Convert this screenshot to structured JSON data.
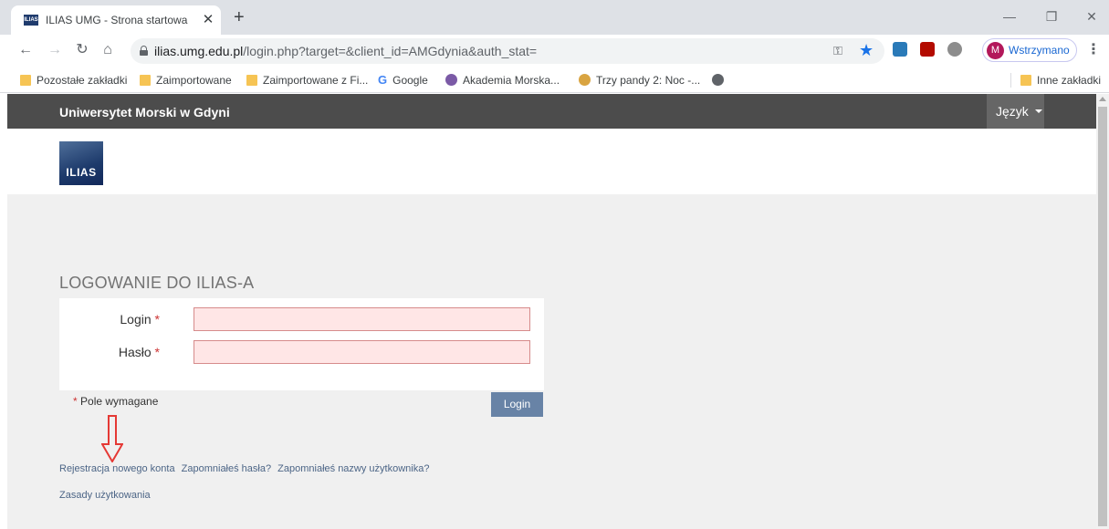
{
  "browser": {
    "tab": {
      "favicon_text": "ILIAS",
      "title": "ILIAS UMG - Strona startowa"
    },
    "window_controls": {
      "minimize": "—",
      "restore": "❐",
      "close": "✕"
    },
    "address": {
      "host": "ilias.umg.edu.pl",
      "path": "/login.php?target=&client_id=AMGdynia&auth_stat="
    },
    "profile": {
      "initial": "M",
      "label": "Wstrzymano"
    },
    "bookmarks": [
      {
        "label": "Pozostałe zakładki",
        "icon": "folder-icon"
      },
      {
        "label": "Zaimportowane",
        "icon": "folder-icon"
      },
      {
        "label": "Zaimportowane z Fi...",
        "icon": "folder-icon"
      },
      {
        "label": "Google",
        "icon": "google-icon"
      },
      {
        "label": "Akademia Morska...",
        "icon": "crest-icon"
      },
      {
        "label": "Trzy pandy 2: Noc -...",
        "icon": "panda-icon"
      }
    ],
    "other_bookmarks": "Inne zakładki"
  },
  "page": {
    "site_name": "Uniwersytet Morski w Gdyni",
    "language_label": "Język",
    "logo_text": "ILIAS",
    "login_title": "LOGOWANIE DO ILIAS-A",
    "fields": {
      "login_label": "Login",
      "password_label": "Hasło",
      "required_mark": "*"
    },
    "required_note": "Pole wymagane",
    "login_button": "Login",
    "links": {
      "register": "Rejestracja nowego konta",
      "forgot_password": "Zapomniałeś hasła?",
      "forgot_username": "Zapomniałeś nazwy użytkownika?",
      "terms": "Zasady użytkowania"
    }
  },
  "colors": {
    "topbar": "#4c4c4c",
    "language_button": "#666666",
    "login_button": "#6883a6",
    "required_input_bg": "#ffe6e6",
    "annotation_arrow": "#e53935",
    "link": "#4c6586"
  }
}
